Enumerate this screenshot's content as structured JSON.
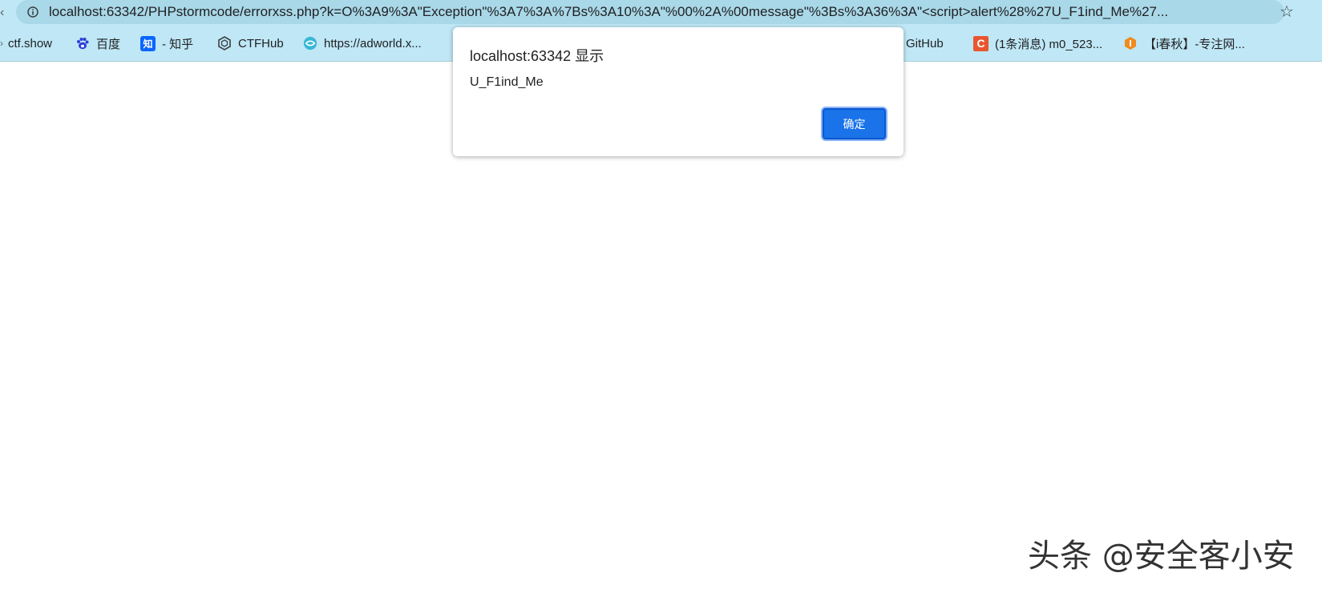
{
  "browser": {
    "url_host": "localhost",
    "url_rest": ":63342/PHPstormcode/errorxss.php?k=O%3A9%3A\"Exception\"%3A7%3A%7Bs%3A10%3A\"%00%2A%00message\"%3Bs%3A36%3A\"<script>alert%28%27U_F1ind_Me%27...",
    "star_icon": "star-icon"
  },
  "bookmarks": [
    {
      "label": "ctf.show",
      "icon": "bookmark-icon"
    },
    {
      "label": "百度",
      "icon": "baidu-icon"
    },
    {
      "label": "- 知乎",
      "icon": "zhihu-icon",
      "icon_text": "知"
    },
    {
      "label": "CTFHub",
      "icon": "ctfhub-icon"
    },
    {
      "label": "https://adworld.x...",
      "icon": "adworld-icon"
    },
    {
      "label": "GitHub",
      "icon": "github-icon"
    },
    {
      "label": "(1条消息) m0_523...",
      "icon": "csdn-icon",
      "icon_text": "C"
    },
    {
      "label": "【i春秋】-专注网...",
      "icon": "ichunqiu-icon"
    }
  ],
  "dialog": {
    "title": "localhost:63342 显示",
    "message": "U_F1ind_Me",
    "ok_label": "确定"
  },
  "watermark": {
    "text": "头条 @安全客小安"
  },
  "colors": {
    "toolbar_bg": "#bfe7f5",
    "omnibox_bg": "#a9d8e8",
    "ok_button": "#1a73e8",
    "csdn_red": "#e8552f",
    "zhihu_blue": "#0a66ff"
  }
}
